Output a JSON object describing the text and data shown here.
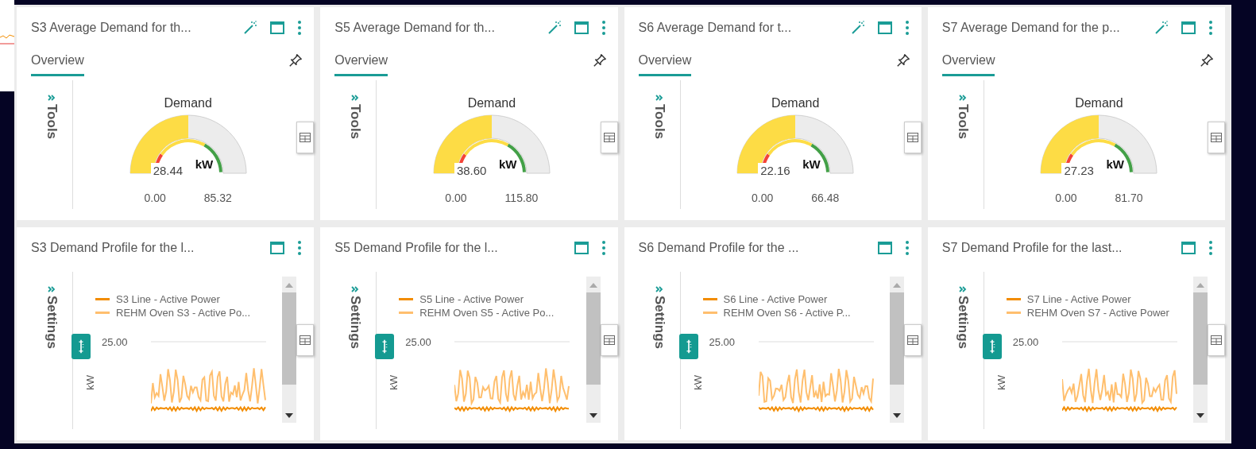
{
  "overview_tiles": [
    {
      "title": "S3 Average Demand for th...",
      "tab": {
        "label": "Overview",
        "selected": true
      },
      "side_label": "Tools",
      "gauge": {
        "title": "Demand",
        "level": 0.5,
        "tooltip": "28.44",
        "unit": "kW",
        "min": "0.00",
        "max": "85.32"
      }
    },
    {
      "title": "S5 Average Demand for th...",
      "tab": {
        "label": "Overview",
        "selected": true
      },
      "side_label": "Tools",
      "gauge": {
        "title": "Demand",
        "level": 0.5,
        "tooltip": "38.60",
        "unit": "kW",
        "min": "0.00",
        "max": "115.80"
      }
    },
    {
      "title": "S6 Average Demand for t...",
      "tab": {
        "label": "Overview",
        "selected": true
      },
      "side_label": "Tools",
      "gauge": {
        "title": "Demand",
        "level": 0.5,
        "tooltip": "22.16",
        "unit": "kW",
        "min": "0.00",
        "max": "66.48"
      }
    },
    {
      "title": "S7 Average Demand for the p...",
      "tab": {
        "label": "Overview",
        "selected": true
      },
      "side_label": "Tools",
      "gauge": {
        "title": "Demand",
        "level": 0.5,
        "tooltip": "27.23",
        "unit": "kW",
        "min": "0.00",
        "max": "81.70"
      }
    }
  ],
  "profile_tiles": [
    {
      "title": "S3 Demand Profile for the l...",
      "side_label": "Settings",
      "legend": [
        {
          "label": "S3 Line - Active Power",
          "color": "#f28c00"
        },
        {
          "label": "REHM Oven S3 - Active Po...",
          "color": "#ffbf6e"
        }
      ],
      "y_tick": "25.00",
      "y_label": "kW"
    },
    {
      "title": "S5 Demand Profile for the l...",
      "side_label": "Settings",
      "legend": [
        {
          "label": "S5 Line - Active Power",
          "color": "#f28c00"
        },
        {
          "label": "REHM Oven S5 - Active Po...",
          "color": "#ffbf6e"
        }
      ],
      "y_tick": "25.00",
      "y_label": "kW"
    },
    {
      "title": "S6 Demand Profile for the ...",
      "side_label": "Settings",
      "legend": [
        {
          "label": "S6 Line - Active Power",
          "color": "#f28c00"
        },
        {
          "label": "REHM Oven S6 - Active P...",
          "color": "#ffbf6e"
        }
      ],
      "y_tick": "25.00",
      "y_label": "kW"
    },
    {
      "title": "S7 Demand Profile for the last...",
      "side_label": "Settings",
      "legend": [
        {
          "label": "S7 Line - Active Power",
          "color": "#f28c00"
        },
        {
          "label": "REHM Oven S7 - Active Power",
          "color": "#ffbf6e"
        }
      ],
      "y_tick": "25.00",
      "y_label": "kW"
    }
  ]
}
